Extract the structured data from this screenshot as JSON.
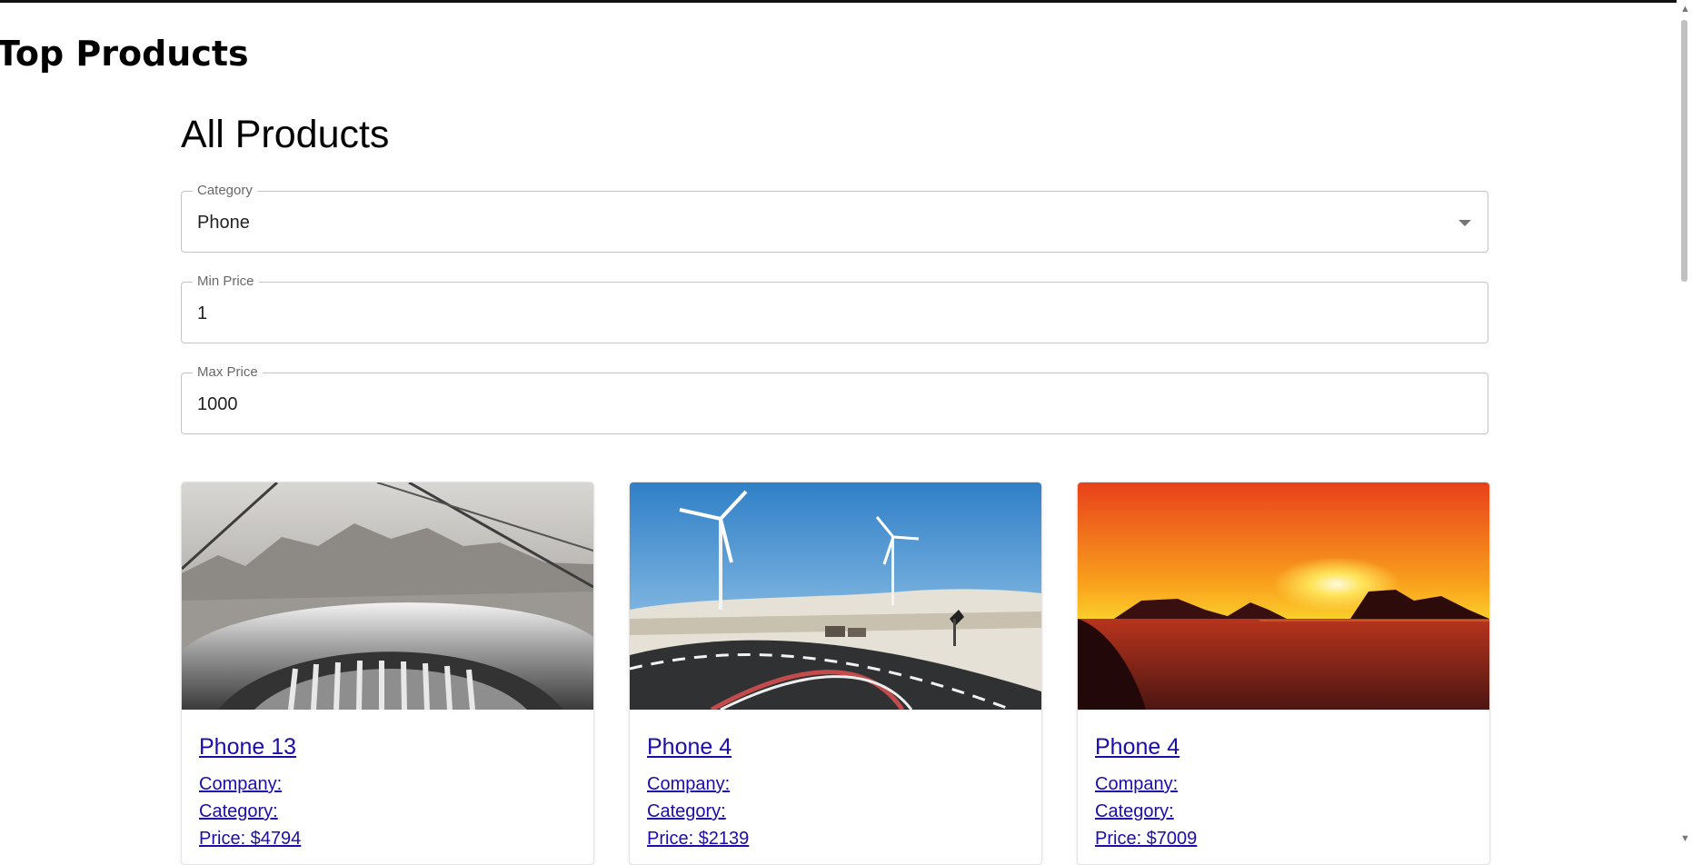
{
  "header": {
    "title": "Top Products"
  },
  "main": {
    "title": "All Products",
    "filters": {
      "category": {
        "label": "Category",
        "value": "Phone"
      },
      "min_price": {
        "label": "Min Price",
        "value": "1"
      },
      "max_price": {
        "label": "Max Price",
        "value": "1000"
      }
    },
    "products": [
      {
        "name": "Phone 13",
        "company": "Company:",
        "category": "Category:",
        "price": "Price: $4794"
      },
      {
        "name": "Phone 4",
        "company": "Company:",
        "category": "Category:",
        "price": "Price: $2139"
      },
      {
        "name": "Phone 4",
        "company": "Company:",
        "category": "Category:",
        "price": "Price: $7009"
      }
    ]
  },
  "colors": {
    "link": "#1a0dab",
    "border": "#c4c4c4",
    "label": "#666666"
  },
  "icons": {
    "select_caret": "chevron-down-icon",
    "scroll_up": "arrow-up-icon",
    "scroll_down": "arrow-down-icon"
  }
}
